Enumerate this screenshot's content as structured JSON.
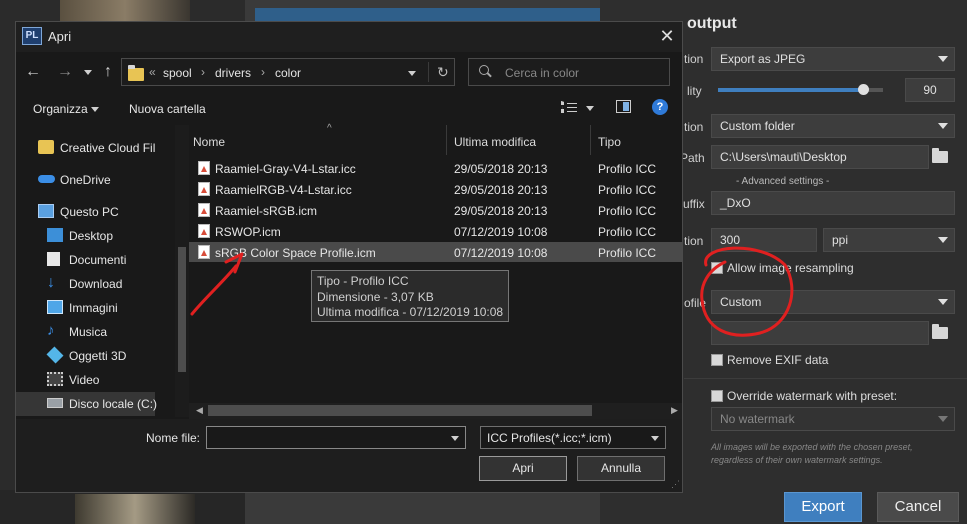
{
  "background": {
    "panel_title": "output",
    "rows": [
      {
        "label": "tion",
        "value": "Export as JPEG"
      },
      {
        "label": "lity",
        "value": "90"
      },
      {
        "label": "tion",
        "value": "Custom folder"
      },
      {
        "label": "Path",
        "value": "C:\\Users\\mauti\\Desktop"
      },
      {
        "label": "uffix",
        "value": "_DxO"
      },
      {
        "label": "tion",
        "value": "300",
        "unit": "ppi"
      },
      {
        "label": "ofile",
        "value": "Custom"
      }
    ],
    "advanced_settings": "- Advanced settings -",
    "allow_resampling": "Allow image resampling",
    "remove_exif": "Remove EXIF data",
    "override_watermark": "Override watermark with preset:",
    "watermark_value": "No watermark",
    "note_line1": "All images will be exported with the chosen preset,",
    "note_line2": "regardless of their own watermark settings.",
    "export_label": "Export",
    "cancel_label": "Cancel",
    "quality_fraction": 0.88
  },
  "dialog": {
    "app_icon": "PL",
    "title": "Apri",
    "address": {
      "prefix": "«",
      "crumbs": [
        "spool",
        "drivers",
        "color"
      ]
    },
    "search_placeholder": "Cerca in color",
    "toolbar": {
      "organize": "Organizza",
      "new_folder": "Nuova cartella"
    },
    "nav": [
      {
        "label": "Creative Cloud Fil",
        "icon": "creative-cloud-icon"
      },
      {
        "label": "OneDrive",
        "icon": "cloud-icon"
      },
      {
        "label": "Questo PC",
        "icon": "computer-icon"
      },
      {
        "label": "Desktop",
        "icon": "desktop-icon"
      },
      {
        "label": "Documenti",
        "icon": "documents-icon"
      },
      {
        "label": "Download",
        "icon": "download-icon"
      },
      {
        "label": "Immagini",
        "icon": "pictures-icon"
      },
      {
        "label": "Musica",
        "icon": "music-icon"
      },
      {
        "label": "Oggetti 3D",
        "icon": "3d-objects-icon"
      },
      {
        "label": "Video",
        "icon": "video-icon"
      },
      {
        "label": "Disco locale (C:)",
        "icon": "drive-icon"
      }
    ],
    "columns": {
      "name": "Nome",
      "modified": "Ultima modifica",
      "type": "Tipo"
    },
    "files": [
      {
        "name": "Raamiel-Gray-V4-Lstar.icc",
        "modified": "29/05/2018 20:13",
        "type": "Profilo ICC"
      },
      {
        "name": "RaamielRGB-V4-Lstar.icc",
        "modified": "29/05/2018 20:13",
        "type": "Profilo ICC"
      },
      {
        "name": "Raamiel-sRGB.icm",
        "modified": "29/05/2018 20:13",
        "type": "Profilo ICC"
      },
      {
        "name": "RSWOP.icm",
        "modified": "07/12/2019 10:08",
        "type": "Profilo ICC"
      },
      {
        "name": "sRGB Color Space Profile.icm",
        "modified": "07/12/2019 10:08",
        "type": "Profilo ICC"
      }
    ],
    "tooltip": {
      "line1": "Tipo - Profilo ICC",
      "line2": "Dimensione - 3,07 KB",
      "line3": "Ultima modifica - 07/12/2019 10:08"
    },
    "filename_label": "Nome file:",
    "filename_value": "",
    "filter": "ICC Profiles(*.icc;*.icm)",
    "open_label": "Apri",
    "cancel_label": "Annulla"
  },
  "colors": {
    "annotation_red": "#e02020",
    "accent_blue": "#3f7fbf"
  }
}
